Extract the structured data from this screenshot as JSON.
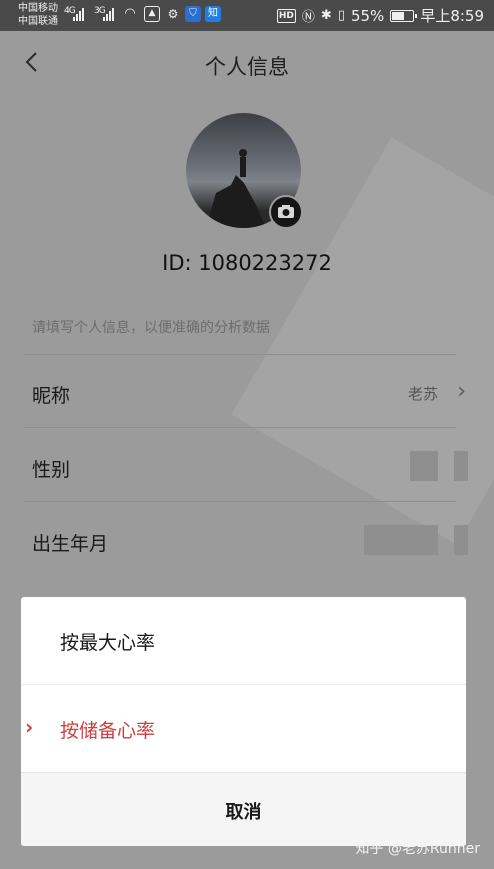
{
  "status_bar": {
    "carrier1": "中国移动",
    "carrier2": "中国联通",
    "sig1": "4G",
    "sig2": "3G",
    "app_icon": "知",
    "hd": "HD",
    "battery_pct": "55%",
    "time": "早上8:59"
  },
  "header": {
    "back_icon": "chevron-left-icon",
    "title": "个人信息"
  },
  "profile": {
    "id_text": "ID: 1080223272",
    "camera_icon": "camera-icon"
  },
  "form": {
    "hint": "请填写个人信息，以便准确的分析数据",
    "rows": [
      {
        "label": "昵称",
        "value": "老苏"
      },
      {
        "label": "性别"
      },
      {
        "label": "出生年月"
      }
    ]
  },
  "dialog": {
    "options": [
      {
        "label": "按最大心率",
        "selected": false
      },
      {
        "label": "按储备心率",
        "selected": true
      }
    ],
    "cancel_label": "取消",
    "accent_color": "#d03e3e"
  },
  "watermark": "知乎 @老苏Runner"
}
